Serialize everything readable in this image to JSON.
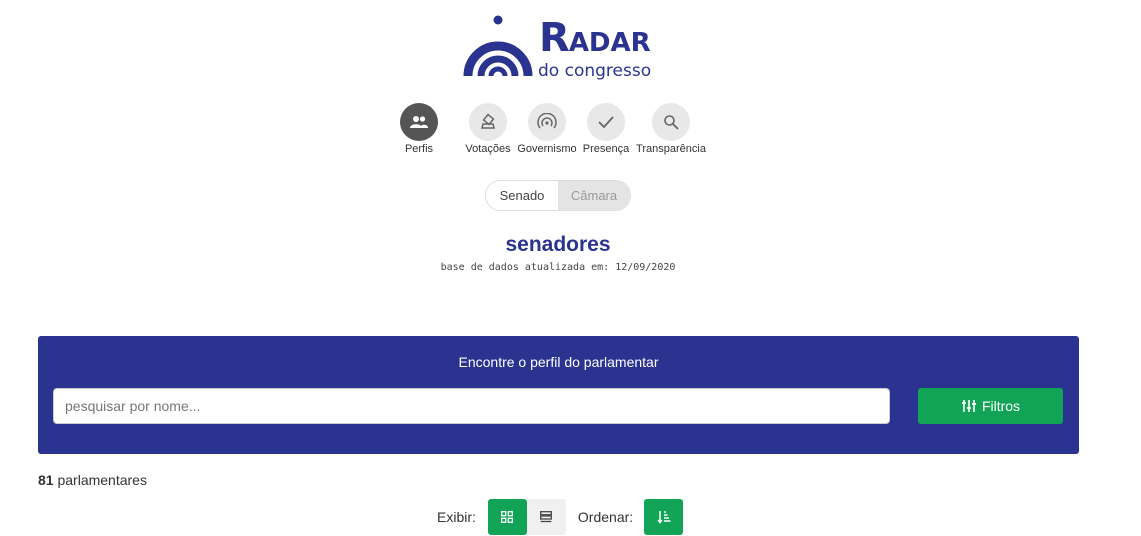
{
  "brand": {
    "word": "ADAR",
    "initial": "R",
    "sub": "do congresso",
    "color": "#2b3390"
  },
  "nav": [
    {
      "label": "Perfis",
      "icon": "people-icon",
      "active": true
    },
    {
      "label": "Votações",
      "icon": "ballot-icon",
      "active": false
    },
    {
      "label": "Governismo",
      "icon": "radar-icon",
      "active": false
    },
    {
      "label": "Presença",
      "icon": "check-icon",
      "active": false
    },
    {
      "label": "Transparência",
      "icon": "search-icon",
      "active": false
    }
  ],
  "house_toggle": {
    "senado": "Senado",
    "camara": "Câmara",
    "selected": "Senado"
  },
  "page": {
    "title": "senadores",
    "updated": "base de dados atualizada em: 12/09/2020"
  },
  "search": {
    "heading": "Encontre o perfil do parlamentar",
    "placeholder": "pesquisar por nome...",
    "value": "",
    "filters_label": "Filtros"
  },
  "results": {
    "count": "81",
    "count_label": "parlamentares"
  },
  "view": {
    "exibir_label": "Exibir:",
    "ordenar_label": "Ordenar:",
    "selected": "grid-view-icon"
  },
  "colors": {
    "primary": "#2b3390",
    "accent": "#12a456"
  }
}
